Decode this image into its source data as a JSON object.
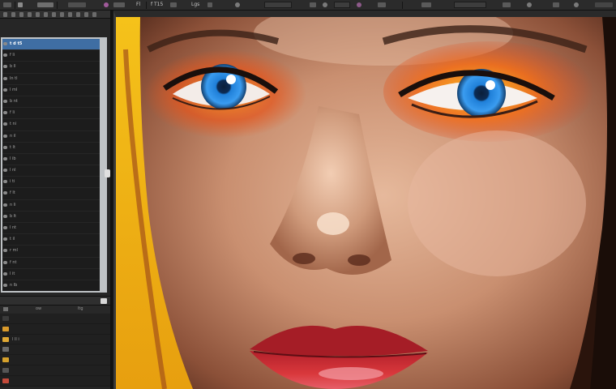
{
  "options_bar": {
    "file_label": "Fl",
    "tool_label": "f T15",
    "mode_label": "Lgs"
  },
  "layers_panel": {
    "selected_layer": "t d t5",
    "layer_rows": [
      "t d t5",
      "f li",
      "b ll",
      "ln tl",
      "l ml",
      "b nt",
      "f li",
      "t ni",
      "n il",
      "t lt",
      "l ib",
      "l nl",
      "i ti",
      "f lt",
      "n li",
      "b lt",
      "l nt",
      "t il",
      "r ml",
      "f nt",
      "l it",
      "n lb"
    ]
  },
  "adjustments_panel": {
    "sub_label_left": "ow",
    "sub_label_right": "ltg",
    "rows": [
      {
        "label": "",
        "thumb_color": "#3a3a3a"
      },
      {
        "label": "",
        "thumb_color": "#d99a2b"
      },
      {
        "label": "l ll i",
        "thumb_color": "#e0a834"
      },
      {
        "label": "",
        "thumb_color": "#6a6a6a"
      },
      {
        "label": "",
        "thumb_color": "#d4a02c"
      },
      {
        "label": "",
        "thumb_color": "#555555"
      },
      {
        "label": "",
        "thumb_color": "#c34a3a"
      }
    ]
  },
  "canvas": {
    "subject": "close-up portrait with blue eyes and orange eyeshadow",
    "accent_colors": {
      "iris": "#2f8fe0",
      "eyeshadow": "#f07a1e",
      "lips": "#c8282e",
      "background": "#f2b416",
      "skin": "#d9a98c"
    }
  },
  "icons": {
    "visibility": "eye-icon",
    "panel_tab": "panel-tab-icon",
    "scroll": "scrollbar-handle"
  }
}
